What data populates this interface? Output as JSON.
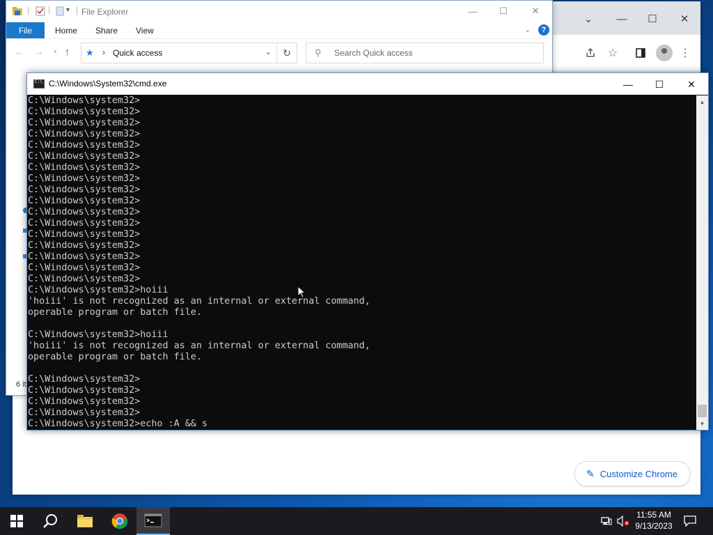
{
  "explorer": {
    "title": "File Explorer",
    "ribbon": {
      "file": "File",
      "home": "Home",
      "share": "Share",
      "view": "View"
    },
    "address": "Quick access",
    "search_placeholder": "Search Quick access",
    "status": "6 it"
  },
  "cmd": {
    "title": "C:\\Windows\\System32\\cmd.exe",
    "lines": [
      "C:\\Windows\\system32>",
      "C:\\Windows\\system32>",
      "C:\\Windows\\system32>",
      "C:\\Windows\\system32>",
      "C:\\Windows\\system32>",
      "C:\\Windows\\system32>",
      "C:\\Windows\\system32>",
      "C:\\Windows\\system32>",
      "C:\\Windows\\system32>",
      "C:\\Windows\\system32>",
      "C:\\Windows\\system32>",
      "C:\\Windows\\system32>",
      "C:\\Windows\\system32>",
      "C:\\Windows\\system32>",
      "C:\\Windows\\system32>",
      "C:\\Windows\\system32>",
      "C:\\Windows\\system32>",
      "C:\\Windows\\system32>hoiii",
      "'hoiii' is not recognized as an internal or external command,",
      "operable program or batch file.",
      "",
      "C:\\Windows\\system32>hoiii",
      "'hoiii' is not recognized as an internal or external command,",
      "operable program or batch file.",
      "",
      "C:\\Windows\\system32>",
      "C:\\Windows\\system32>",
      "C:\\Windows\\system32>",
      "C:\\Windows\\system32>",
      "C:\\Windows\\system32>echo :A && s"
    ]
  },
  "chrome": {
    "customize_label": "Customize Chrome"
  },
  "taskbar": {
    "time": "11:55 AM",
    "date": "9/13/2023"
  },
  "colors": {
    "accent": "#1979ca",
    "console_bg": "#0c0c0c",
    "console_fg": "#cccccc",
    "taskbar_bg": "#1b1b1f"
  }
}
